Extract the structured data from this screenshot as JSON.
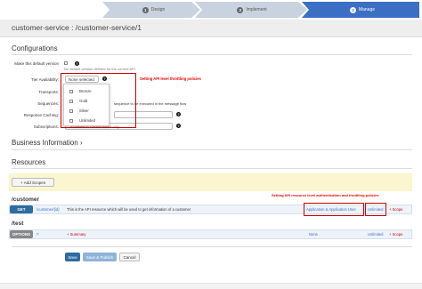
{
  "wizard": {
    "steps": [
      {
        "num": "1",
        "label": "Design"
      },
      {
        "num": "2",
        "label": "Implement"
      },
      {
        "num": "3",
        "label": "Manage"
      }
    ]
  },
  "header": {
    "title": "customer-service : /customer-service/1"
  },
  "config": {
    "title": "Configurations",
    "default_label": "Make this default version",
    "default_note": "No default version defined for the current API",
    "tier_label": "Tier Availability:",
    "tier_value": "None selected",
    "tier_annotation": "Setting API level throttling policies",
    "tiers": [
      "Bronze",
      "Gold",
      "Silver",
      "Unlimited"
    ],
    "transports_label": "Transports:",
    "sequences_label": "Sequences:",
    "sequences_note": "sequence to be executed in the message flow",
    "caching_label": "Response Caching:",
    "subscriptions_label": "Subscriptions:",
    "subscriptions_value": "Available to current tenant only"
  },
  "business": {
    "title": "Business Information"
  },
  "resources": {
    "title": "Resources",
    "add_scopes": "Add Scopes",
    "annotation": "Setting API resource level authentication and throttling policies",
    "groups": [
      {
        "path": "/customer",
        "rows": [
          {
            "method": "GET",
            "url": "/customer/{id}",
            "description": "This is the API resource which will be used to get information of a customer",
            "auth": "Application & Application User",
            "tier": "Unlimited",
            "scope": "+ Scope"
          }
        ]
      },
      {
        "path": "/test",
        "rows": [
          {
            "method": "OPTIONS",
            "url": "/*",
            "description": "+ Summary",
            "auth": "None",
            "tier": "Unlimited",
            "scope": "+ Scope"
          }
        ]
      }
    ]
  },
  "actions": {
    "save": "Save",
    "save_publish": "Save & Publish",
    "cancel": "Cancel"
  },
  "colors": {
    "primary": "#2d6ca2",
    "wizard_active": "#3a6fc4",
    "wizard_inactive": "#c9d3df",
    "highlight": "#cc0000",
    "get": "#2d6ca2",
    "options": "#888888"
  }
}
